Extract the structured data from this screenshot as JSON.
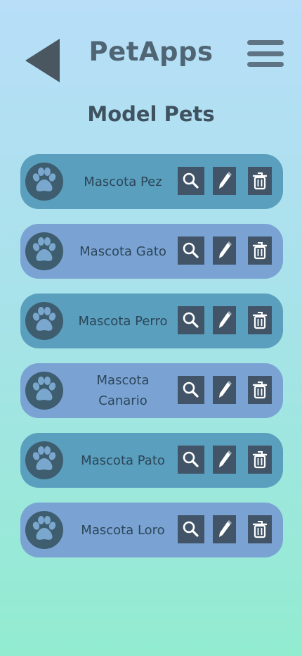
{
  "header": {
    "title": "PetApps",
    "back_icon": "back-arrow-icon",
    "menu_icon": "hamburger-menu-icon"
  },
  "page": {
    "title": "Model Pets"
  },
  "pets": [
    {
      "name": "Mascota Pez"
    },
    {
      "name": "Mascota Gato"
    },
    {
      "name": "Mascota Perro"
    },
    {
      "name": "Mascota Canario"
    },
    {
      "name": "Mascota Pato"
    },
    {
      "name": "Mascota Loro"
    }
  ],
  "icons": {
    "avatar": "paw-icon",
    "view": "search-icon",
    "edit": "pencil-icon",
    "delete": "trash-icon"
  },
  "colors": {
    "card_primary": "#5a9fbe",
    "card_secondary": "#7aa3d4",
    "action_button": "#425568",
    "title": "#4f6574"
  }
}
